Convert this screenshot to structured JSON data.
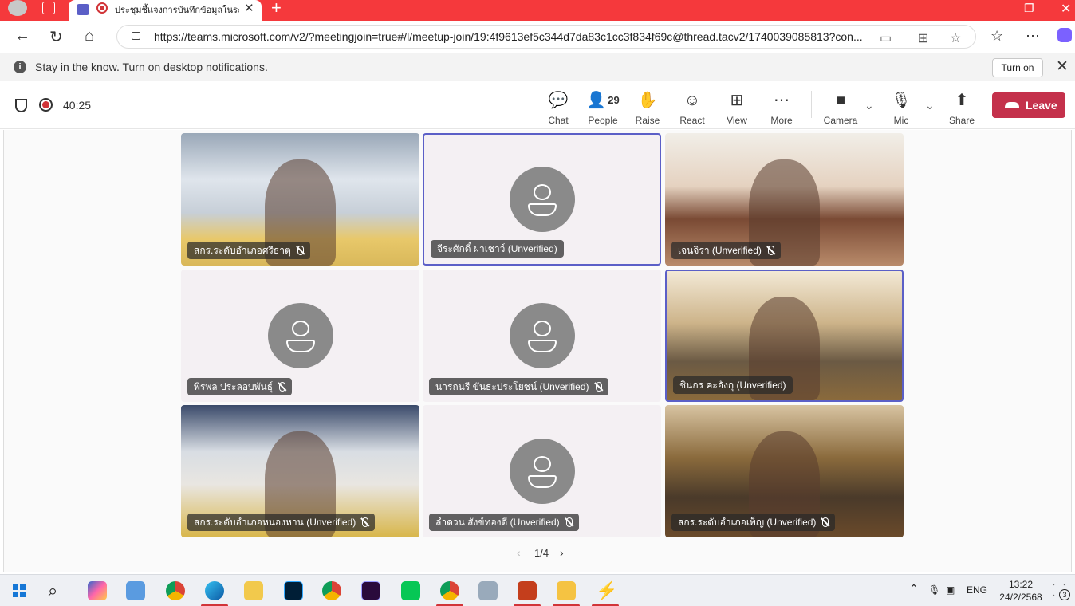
{
  "browser": {
    "tab_title": "ประชุมชี้แจงการบันทึกข้อมูลในระบบ",
    "url": "https://teams.microsoft.com/v2/?meetingjoin=true#/l/meetup-join/19:4f9613ef5c344d7da83c1cc3f834f69c@thread.tacv2/1740039085813?con...",
    "new_tab_glyph": "+",
    "close_glyph": "✕"
  },
  "notification": {
    "text": "Stay in the know. Turn on desktop notifications.",
    "button": "Turn on"
  },
  "meeting": {
    "timer": "40:25",
    "people_count": "29",
    "toolbar": {
      "chat": "Chat",
      "people": "People",
      "raise": "Raise",
      "react": "React",
      "view": "View",
      "more": "More",
      "camera": "Camera",
      "mic": "Mic",
      "share": "Share",
      "leave": "Leave"
    },
    "participants": [
      {
        "name": "สกร.ระดับอำเภอศรีธาตุ",
        "video": true,
        "muted": true,
        "active": false
      },
      {
        "name": "จีระศักดิ์ ผาเชาว์ (Unverified)",
        "video": false,
        "muted": false,
        "active": true
      },
      {
        "name": "เจนจิรา (Unverified)",
        "video": true,
        "muted": true,
        "active": false
      },
      {
        "name": "พีรพล ประลอบพันธุ์",
        "video": false,
        "muted": true,
        "active": false
      },
      {
        "name": "นารถนรี ขันธะประโยชน์ (Unverified)",
        "video": false,
        "muted": true,
        "active": false
      },
      {
        "name": "ชินกร คะอังกุ (Unverified)",
        "video": true,
        "muted": false,
        "active": true
      },
      {
        "name": "สกร.ระดับอำเภอหนองหาน (Unverified)",
        "video": true,
        "muted": true,
        "active": false
      },
      {
        "name": "ลำดวน สังข์ทองดี (Unverified)",
        "video": false,
        "muted": true,
        "active": false
      },
      {
        "name": "สกร.ระดับอำเภอเพ็ญ (Unverified)",
        "video": true,
        "muted": true,
        "active": false
      }
    ],
    "pager": "1/4"
  },
  "taskbar": {
    "language": "ENG",
    "time": "13:22",
    "date": "24/2/2568",
    "notification_count": "3"
  },
  "colors": {
    "titlebar": "#f5393c",
    "teams_accent": "#5b5fc7",
    "leave_button": "#c4314b"
  }
}
